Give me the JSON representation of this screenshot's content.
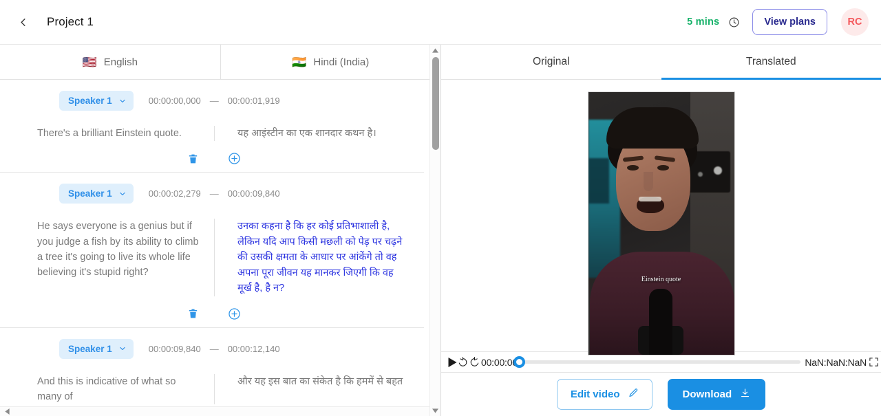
{
  "header": {
    "back_icon": "chevron-left-icon",
    "project_title": "Project 1",
    "credits": "5 mins",
    "clock_icon": "clock-icon",
    "view_plans_label": "View plans",
    "avatar_initials": "RC",
    "credits_color": "#17b26a",
    "avatar_bg": "#fdeaea",
    "avatar_color": "#f4585c"
  },
  "language_tabs": [
    {
      "label": "English",
      "flag": "🇺🇸",
      "icon": "us-flag-icon",
      "active": false
    },
    {
      "label": "Hindi (India)",
      "flag": "🇮🇳",
      "icon": "india-flag-icon",
      "active": false
    }
  ],
  "view_tabs": [
    {
      "label": "Original",
      "active": false
    },
    {
      "label": "Translated",
      "active": true
    }
  ],
  "segments": [
    {
      "speaker": "Speaker 1",
      "start": "00:00:00,000",
      "separator": "—",
      "end": "00:00:01,919",
      "source_text": "There's a brilliant Einstein quote.",
      "target_text": "यह आइंस्टीन का एक शानदार कथन है।",
      "target_highlighted": false,
      "delete_icon": "trash-icon",
      "add_icon": "plus-circle-icon"
    },
    {
      "speaker": "Speaker 1",
      "start": "00:00:02,279",
      "separator": "—",
      "end": "00:00:09,840",
      "source_text": "He says everyone is a genius but if you judge a fish by its ability to climb a tree it's going to live its whole life believing it's stupid right?",
      "target_text": "उनका कहना है कि हर कोई प्रतिभाशाली है, लेकिन यदि आप किसी मछली को पेड़ पर चढ़ने की उसकी क्षमता के आधार पर आंकेंगे तो वह अपना पूरा जीवन यह मानकर जिएगी कि वह मूर्ख है, है न?",
      "target_highlighted": true,
      "delete_icon": "trash-icon",
      "add_icon": "plus-circle-icon"
    },
    {
      "speaker": "Speaker 1",
      "start": "00:00:09,840",
      "separator": "—",
      "end": "00:00:12,140",
      "source_text": "And this is indicative of what so many of",
      "target_text": "और यह इस बात का संकेत है कि हममें से बहत",
      "target_highlighted": false,
      "delete_icon": "trash-icon",
      "add_icon": "plus-circle-icon"
    }
  ],
  "video": {
    "caption_overlay": "Einstein quote"
  },
  "player": {
    "play_icon": "play-icon",
    "rewind_icon": "rewind-10-icon",
    "forward_icon": "forward-10-icon",
    "current_time": "00:00:00",
    "duration": "NaN:NaN:NaN",
    "fullscreen_icon": "fullscreen-icon",
    "progress_percent": 0
  },
  "footer_actions": {
    "edit_label": "Edit video",
    "edit_icon": "pencil-icon",
    "download_label": "Download",
    "download_icon": "download-icon",
    "download_bg": "#1a8fe3"
  },
  "scrollbars": {
    "v_up_icon": "caret-up-icon",
    "v_down_icon": "caret-down-icon",
    "h_left_icon": "caret-left-icon",
    "h_right_icon": "caret-right-icon"
  }
}
